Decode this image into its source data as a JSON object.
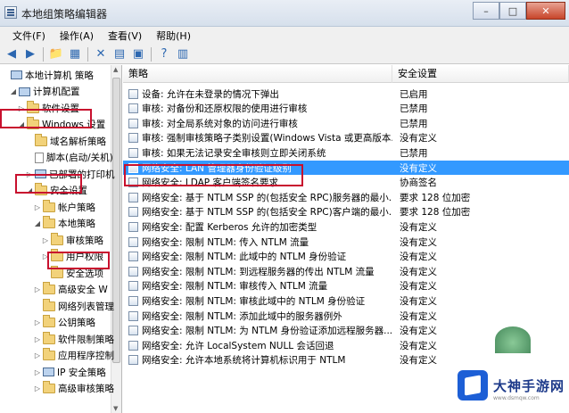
{
  "window": {
    "title": "本地组策略编辑器",
    "controls": [
      "–",
      "□",
      "✕"
    ]
  },
  "menu": [
    "文件(F)",
    "操作(A)",
    "查看(V)",
    "帮助(H)"
  ],
  "toolbar": [
    "◀",
    "▶",
    "📁",
    "▦",
    "✕",
    "▤",
    "▣",
    "?",
    "▥"
  ],
  "tree": [
    {
      "label": "本地计算机 策略",
      "indent": 0,
      "icon": "pc-icon",
      "twisty": ""
    },
    {
      "label": "计算机配置",
      "indent": 1,
      "icon": "pc-icon",
      "twisty": "◢"
    },
    {
      "label": "软件设置",
      "indent": 2,
      "icon": "folder",
      "twisty": "▷"
    },
    {
      "label": "Windows 设置",
      "indent": 2,
      "icon": "folder",
      "twisty": "◢"
    },
    {
      "label": "域名解析策略",
      "indent": 3,
      "icon": "folder",
      "twisty": ""
    },
    {
      "label": "脚本(启动/关机)",
      "indent": 3,
      "icon": "doc-icon",
      "twisty": ""
    },
    {
      "label": "已部署的打印机",
      "indent": 3,
      "icon": "pc-icon",
      "twisty": "▷"
    },
    {
      "label": "安全设置",
      "indent": 3,
      "icon": "folder",
      "twisty": "◢"
    },
    {
      "label": "帐户策略",
      "indent": 4,
      "icon": "folder",
      "twisty": "▷"
    },
    {
      "label": "本地策略",
      "indent": 4,
      "icon": "folder",
      "twisty": "◢"
    },
    {
      "label": "审核策略",
      "indent": 5,
      "icon": "folder",
      "twisty": "▷"
    },
    {
      "label": "用户权限",
      "indent": 5,
      "icon": "folder",
      "twisty": "▷"
    },
    {
      "label": "安全选项",
      "indent": 5,
      "icon": "folder",
      "twisty": ""
    },
    {
      "label": "高级安全 W",
      "indent": 4,
      "icon": "folder",
      "twisty": "▷"
    },
    {
      "label": "网络列表管理",
      "indent": 4,
      "icon": "folder",
      "twisty": ""
    },
    {
      "label": "公钥策略",
      "indent": 4,
      "icon": "folder",
      "twisty": "▷"
    },
    {
      "label": "软件限制策略",
      "indent": 4,
      "icon": "folder",
      "twisty": "▷"
    },
    {
      "label": "应用程序控制",
      "indent": 4,
      "icon": "folder",
      "twisty": "▷"
    },
    {
      "label": "IP 安全策略",
      "indent": 4,
      "icon": "pc-icon",
      "twisty": "▷"
    },
    {
      "label": "高级审核策略",
      "indent": 4,
      "icon": "folder",
      "twisty": "▷"
    }
  ],
  "list": {
    "headers": {
      "policy": "策略",
      "setting": "安全设置"
    },
    "rows": [
      {
        "policy": "设备: 允许在未登录的情况下弹出",
        "setting": "已启用"
      },
      {
        "policy": "审核: 对备份和还原权限的使用进行审核",
        "setting": "已禁用"
      },
      {
        "policy": "审核: 对全局系统对象的访问进行审核",
        "setting": "已禁用"
      },
      {
        "policy": "审核: 强制审核策略子类别设置(Windows Vista 或更高版本...",
        "setting": "没有定义"
      },
      {
        "policy": "审核: 如果无法记录安全审核则立即关闭系统",
        "setting": "已禁用"
      },
      {
        "policy": "网络安全: LAN 管理器身份验证级别",
        "setting": "没有定义"
      },
      {
        "policy": "网络安全: LDAP 客户端签名要求",
        "setting": "协商签名"
      },
      {
        "policy": "网络安全: 基于 NTLM SSP 的(包括安全 RPC)服务器的最小...",
        "setting": "要求 128 位加密"
      },
      {
        "policy": "网络安全: 基于 NTLM SSP 的(包括安全 RPC)客户端的最小...",
        "setting": "要求 128 位加密"
      },
      {
        "policy": "网络安全: 配置 Kerberos 允许的加密类型",
        "setting": "没有定义"
      },
      {
        "policy": "网络安全: 限制 NTLM: 传入 NTLM 流量",
        "setting": "没有定义"
      },
      {
        "policy": "网络安全: 限制 NTLM: 此域中的 NTLM 身份验证",
        "setting": "没有定义"
      },
      {
        "policy": "网络安全: 限制 NTLM: 到远程服务器的传出 NTLM 流量",
        "setting": "没有定义"
      },
      {
        "policy": "网络安全: 限制 NTLM: 审核传入 NTLM 流量",
        "setting": "没有定义"
      },
      {
        "policy": "网络安全: 限制 NTLM: 审核此域中的 NTLM 身份验证",
        "setting": "没有定义"
      },
      {
        "policy": "网络安全: 限制 NTLM: 添加此域中的服务器例外",
        "setting": "没有定义"
      },
      {
        "policy": "网络安全: 限制 NTLM: 为 NTLM 身份验证添加远程服务器...",
        "setting": "没有定义"
      },
      {
        "policy": "网络安全: 允许 LocalSystem NULL 会话回退",
        "setting": "没有定义"
      },
      {
        "policy": "网络安全: 允许本地系统将计算机标识用于 NTLM",
        "setting": "没有定义"
      }
    ],
    "selected_index": 5
  },
  "watermark": {
    "brand": "大神手游网",
    "sub": "www.dsmqw.com"
  },
  "colors": {
    "selection": "#3399ff",
    "highlight": "#c8102e"
  }
}
